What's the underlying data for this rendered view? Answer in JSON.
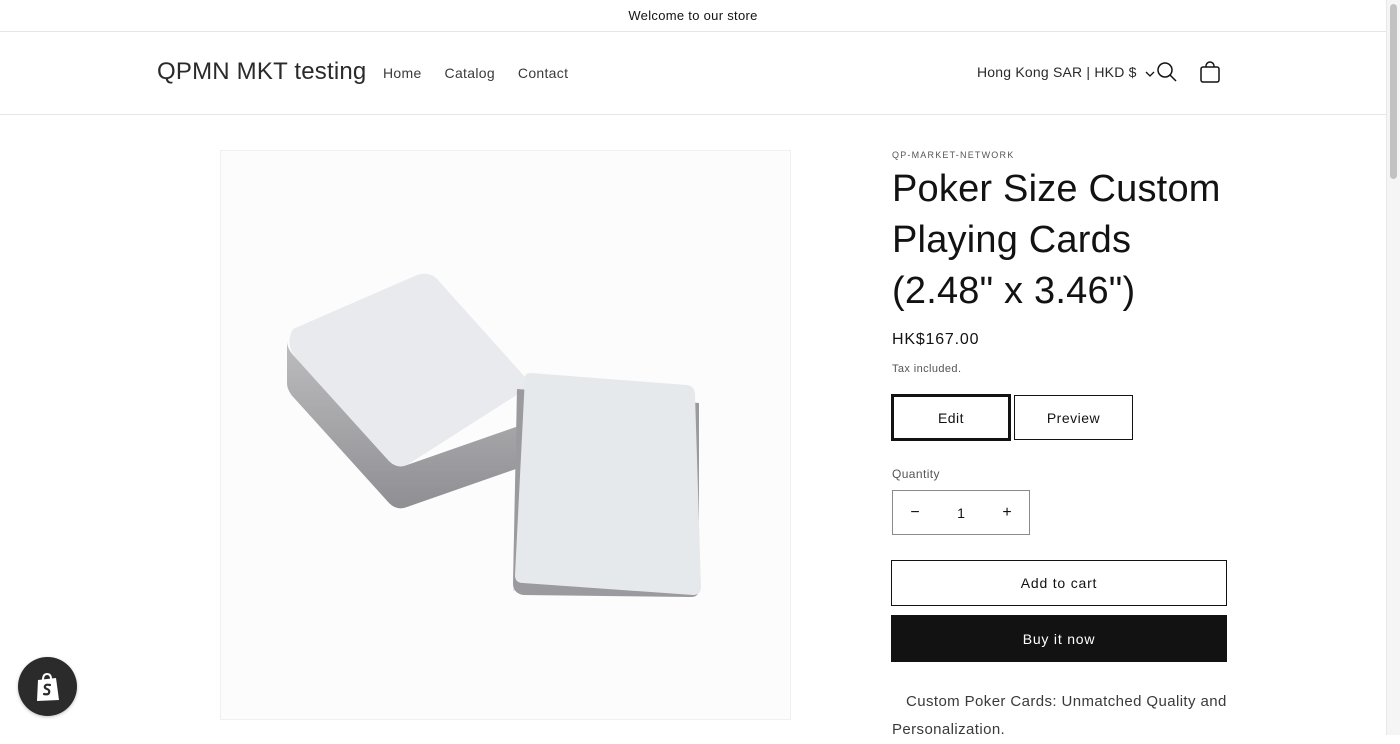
{
  "announcement": {
    "text": "Welcome to our store"
  },
  "header": {
    "logo": "QPMN MKT testing",
    "nav": [
      {
        "label": "Home"
      },
      {
        "label": "Catalog"
      },
      {
        "label": "Contact"
      }
    ],
    "country_selector": "Hong Kong SAR | HKD $",
    "icons": [
      "search-icon",
      "cart-icon",
      "chevron-down-icon"
    ]
  },
  "product": {
    "vendor": "QP-MARKET-NETWORK",
    "title": "Poker Size Custom Playing Cards (2.48\" x 3.46\")",
    "price": "HK$167.00",
    "tax_note": "Tax included.",
    "edit_label": "Edit",
    "preview_label": "Preview",
    "quantity_label": "Quantity",
    "quantity_value": "1",
    "quantity_decrease": "−",
    "quantity_increase": "+",
    "add_to_cart_label": "Add to cart",
    "buy_now_label": "Buy it now",
    "description": "Custom Poker Cards: Unmatched Quality and Personalization."
  },
  "colors": {
    "text": "#121212",
    "buy_button_bg": "#121212",
    "badge_bg": "#2b2b2b"
  }
}
